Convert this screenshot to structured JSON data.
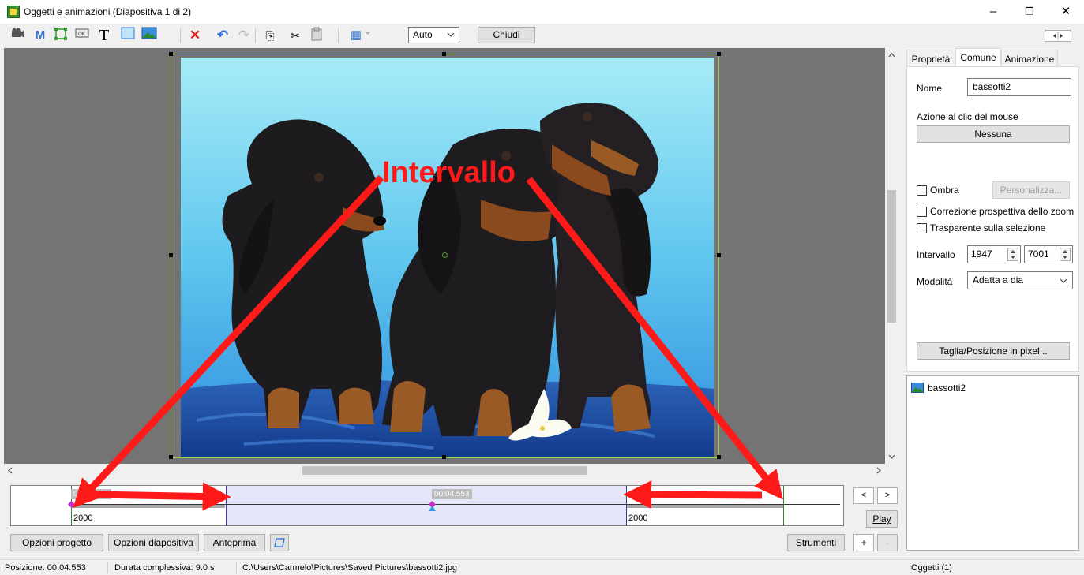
{
  "window": {
    "title": "Oggetti e animazioni  (Diapositiva 1 di 2)",
    "minimize_glyph": "–",
    "restore_glyph": "❐",
    "close_glyph": "✕"
  },
  "toolbar": {
    "icons": [
      "camera-icon",
      "text-m-icon",
      "frame-icon",
      "button-icon",
      "text-t-icon",
      "rectangle-icon",
      "image-icon",
      "delete-icon",
      "undo-icon",
      "redo-icon",
      "copy-icon",
      "cut-icon",
      "paste-icon",
      "grid-icon"
    ],
    "icon_glyphs": {
      "m": "M",
      "t": "T",
      "ok": "OK",
      "delete": "✕",
      "undo": "↶",
      "redo": "↷",
      "copy": "⎘",
      "cut": "✂",
      "grid": "▦"
    },
    "zoom_value": "Auto",
    "close_label": "Chiudi"
  },
  "canvas": {
    "annotation_label": "Intervallo",
    "annotation_color": "#ff1a1a",
    "background_color": "#747474"
  },
  "timeline": {
    "left_time": "00:00.553",
    "center_time": "00:04.553",
    "left_value": "2000",
    "right_value": "2000",
    "nav_prev": "<",
    "nav_next": ">",
    "play_label": "Play"
  },
  "bottom_buttons": {
    "project_options": "Opzioni progetto",
    "slide_options": "Opzioni diapositiva",
    "preview": "Anteprima",
    "tools": "Strumenti",
    "add": "+",
    "remove": "-"
  },
  "status": {
    "position": "Posizione:  00:04.553",
    "duration": "Durata complessiva:  9.0 s",
    "path": "C:\\Users\\Carmelo\\Pictures\\Saved Pictures\\bassotti2.jpg",
    "objects": "Oggetti (1)"
  },
  "panel": {
    "tabs": [
      "Proprietà",
      "Comune",
      "Animazione"
    ],
    "active_tab": "Comune",
    "name_label": "Nome",
    "name_value": "bassotti2",
    "mouse_action_label": "Azione al clic del mouse",
    "mouse_action_value": "Nessuna",
    "shadow_label": "Ombra",
    "customize_label": "Personalizza...",
    "perspective_label": "Correzione prospettiva dello zoom",
    "transparent_label": "Trasparente sulla selezione",
    "interval_label": "Intervallo",
    "interval_start": "1947",
    "interval_end": "7001",
    "mode_label": "Modalità",
    "mode_value": "Adatta a dia",
    "crop_button": "Taglia/Posizione in pixel..."
  },
  "object_list": {
    "items": [
      "bassotti2"
    ]
  }
}
